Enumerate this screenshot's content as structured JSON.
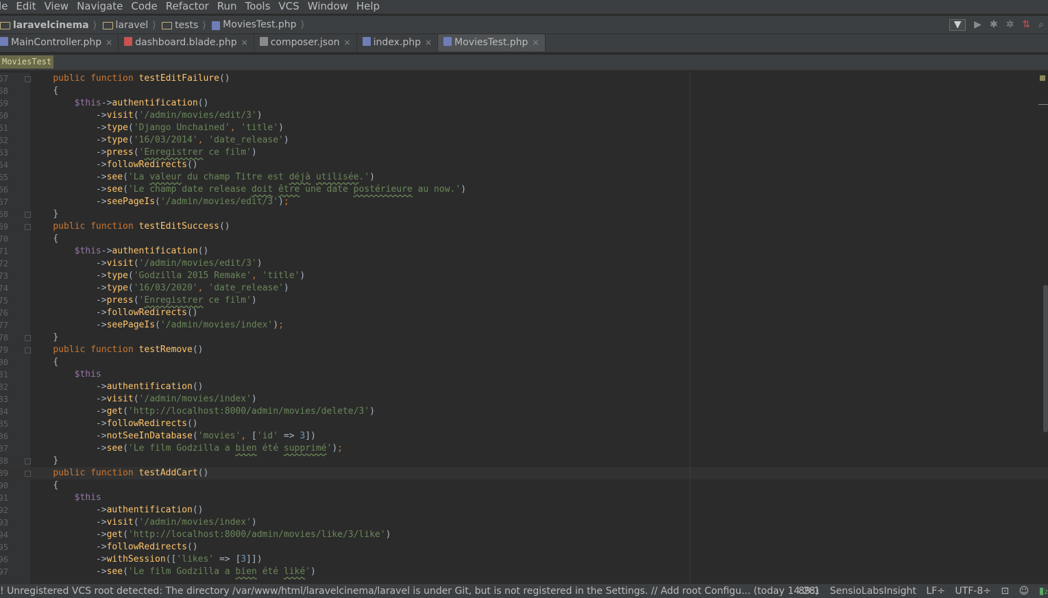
{
  "menu": [
    "le",
    "Edit",
    "View",
    "Navigate",
    "Code",
    "Refactor",
    "Run",
    "Tools",
    "VCS",
    "Window",
    "Help"
  ],
  "breadcrumb": [
    "laravelcinema",
    "laravel",
    "tests",
    "MoviesTest.php"
  ],
  "tabs": [
    {
      "label": "MainController.php",
      "icon": "php-file-icon",
      "active": false
    },
    {
      "label": "dashboard.blade.php",
      "icon": "blade-file-icon",
      "active": false
    },
    {
      "label": "composer.json",
      "icon": "json-file-icon",
      "active": false
    },
    {
      "label": "index.php",
      "icon": "php-file-icon",
      "active": false
    },
    {
      "label": "MoviesTest.php",
      "icon": "php-file-icon",
      "active": true
    }
  ],
  "class_crumb": "MoviesTest",
  "code_lines": [
    {
      "n": "57",
      "fold": true,
      "src": "    <span class=\"kw\">public function</span> <span class=\"fn\">testEditFailure</span><span class=\"pl\">()</span>"
    },
    {
      "n": "58",
      "src": "    <span class=\"pl\">{</span>"
    },
    {
      "n": "59",
      "src": "        <span class=\"var\">$this</span><span class=\"pl\">-></span><span class=\"fn\">authentification</span><span class=\"pl\">()</span>"
    },
    {
      "n": "60",
      "src": "            <span class=\"pl\">-></span><span class=\"fn\">visit</span><span class=\"pl\">(</span><span class=\"str\">'/admin/movies/edit/3'</span><span class=\"pl\">)</span>"
    },
    {
      "n": "61",
      "src": "            <span class=\"pl\">-></span><span class=\"fn\">type</span><span class=\"pl\">(</span><span class=\"str\">'Django Unchained'</span><span class=\"kw\">,</span> <span class=\"str\">'title'</span><span class=\"pl\">)</span>"
    },
    {
      "n": "62",
      "src": "            <span class=\"pl\">-></span><span class=\"fn\">type</span><span class=\"pl\">(</span><span class=\"str\">'16/03/2014'</span><span class=\"kw\">,</span> <span class=\"str\">'date_release'</span><span class=\"pl\">)</span>"
    },
    {
      "n": "63",
      "src": "            <span class=\"pl\">-></span><span class=\"fn\">press</span><span class=\"pl\">(</span><span class=\"str\">'<span class=\"typo\">Enregistrer</span> ce film'</span><span class=\"pl\">)</span>"
    },
    {
      "n": "64",
      "src": "            <span class=\"pl\">-></span><span class=\"fn\">followRedirects</span><span class=\"pl\">()</span>"
    },
    {
      "n": "65",
      "src": "            <span class=\"pl\">-></span><span class=\"fn\">see</span><span class=\"pl\">(</span><span class=\"str\">'La <span class=\"typo\">valeur</span> du champ Titre est <span class=\"typo\">déjà</span> <span class=\"typo\">utilisée</span>.'</span><span class=\"pl\">)</span>"
    },
    {
      "n": "66",
      "src": "            <span class=\"pl\">-></span><span class=\"fn\">see</span><span class=\"pl\">(</span><span class=\"str\">'Le champ date release <span class=\"typo\">doit</span> <span class=\"typo\">être</span> une date <span class=\"typo\">postérieure</span> au now.'</span><span class=\"pl\">)</span>"
    },
    {
      "n": "67",
      "src": "            <span class=\"pl\">-></span><span class=\"fn\">seePageIs</span><span class=\"pl\">(</span><span class=\"str\">'/admin/movies/edit/3'</span><span class=\"pl\">)</span><span class=\"kw\">;</span>"
    },
    {
      "n": "68",
      "fold": true,
      "src": "    <span class=\"pl\">}</span>"
    },
    {
      "n": "69",
      "fold": true,
      "src": "    <span class=\"kw\">public function</span> <span class=\"fn\">testEditSuccess</span><span class=\"pl\">()</span>"
    },
    {
      "n": "70",
      "src": "    <span class=\"pl\">{</span>"
    },
    {
      "n": "71",
      "src": "        <span class=\"var\">$this</span><span class=\"pl\">-></span><span class=\"fn\">authentification</span><span class=\"pl\">()</span>"
    },
    {
      "n": "72",
      "src": "            <span class=\"pl\">-></span><span class=\"fn\">visit</span><span class=\"pl\">(</span><span class=\"str\">'/admin/movies/edit/3'</span><span class=\"pl\">)</span>"
    },
    {
      "n": "73",
      "src": "            <span class=\"pl\">-></span><span class=\"fn\">type</span><span class=\"pl\">(</span><span class=\"str\">'Godzilla 2015 Remake'</span><span class=\"kw\">,</span> <span class=\"str\">'title'</span><span class=\"pl\">)</span>"
    },
    {
      "n": "74",
      "src": "            <span class=\"pl\">-></span><span class=\"fn\">type</span><span class=\"pl\">(</span><span class=\"str\">'16/03/2020'</span><span class=\"kw\">,</span> <span class=\"str\">'date_release'</span><span class=\"pl\">)</span>"
    },
    {
      "n": "75",
      "src": "            <span class=\"pl\">-></span><span class=\"fn\">press</span><span class=\"pl\">(</span><span class=\"str\">'<span class=\"typo\">Enregistrer</span> ce film'</span><span class=\"pl\">)</span>"
    },
    {
      "n": "76",
      "src": "            <span class=\"pl\">-></span><span class=\"fn\">followRedirects</span><span class=\"pl\">()</span>"
    },
    {
      "n": "77",
      "src": "            <span class=\"pl\">-></span><span class=\"fn\">seePageIs</span><span class=\"pl\">(</span><span class=\"str\">'/admin/movies/index'</span><span class=\"pl\">)</span><span class=\"kw\">;</span>"
    },
    {
      "n": "78",
      "fold": true,
      "src": "    <span class=\"pl\">}</span>"
    },
    {
      "n": "79",
      "fold": true,
      "src": "    <span class=\"kw\">public function</span> <span class=\"fn\">testRemove</span><span class=\"pl\">()</span>"
    },
    {
      "n": "80",
      "src": "    <span class=\"pl\">{</span>"
    },
    {
      "n": "81",
      "src": "        <span class=\"var\">$this</span>"
    },
    {
      "n": "82",
      "src": "            <span class=\"pl\">-></span><span class=\"fn\">authentification</span><span class=\"pl\">()</span>"
    },
    {
      "n": "83",
      "src": "            <span class=\"pl\">-></span><span class=\"fn\">visit</span><span class=\"pl\">(</span><span class=\"str\">'/admin/movies/index'</span><span class=\"pl\">)</span>"
    },
    {
      "n": "84",
      "src": "            <span class=\"pl\">-></span><span class=\"fn\">get</span><span class=\"pl\">(</span><span class=\"str\">'http://localhost:8000/admin/movies/delete/3'</span><span class=\"pl\">)</span>"
    },
    {
      "n": "85",
      "src": "            <span class=\"pl\">-></span><span class=\"fn\">followRedirects</span><span class=\"pl\">()</span>"
    },
    {
      "n": "86",
      "src": "            <span class=\"pl\">-></span><span class=\"fn\">notSeeInDatabase</span><span class=\"pl\">(</span><span class=\"str\">'movies'</span><span class=\"kw\">,</span> <span class=\"pl\">[</span><span class=\"str\">'id'</span> <span class=\"pl\">=></span> <span class=\"num\">3</span><span class=\"pl\">])</span>"
    },
    {
      "n": "87",
      "src": "            <span class=\"pl\">-></span><span class=\"fn\">see</span><span class=\"pl\">(</span><span class=\"str\">'Le film Godzilla a <span class=\"typo\">bien</span> été <span class=\"typo\">supprimé</span>'</span><span class=\"pl\">)</span><span class=\"kw\">;</span>"
    },
    {
      "n": "88",
      "fold": true,
      "src": "    <span class=\"pl\">}</span>"
    },
    {
      "n": "89",
      "fold": true,
      "current": true,
      "src": "    <span class=\"kw\">public function</span> <span class=\"fn\">testAddCart</span><span class=\"pl\">()</span>"
    },
    {
      "n": "90",
      "src": "    <span class=\"pl\">{</span>"
    },
    {
      "n": "91",
      "src": "        <span class=\"var\">$this</span>"
    },
    {
      "n": "92",
      "src": "            <span class=\"pl\">-></span><span class=\"fn\">authentification</span><span class=\"pl\">()</span>"
    },
    {
      "n": "93",
      "src": "            <span class=\"pl\">-></span><span class=\"fn\">visit</span><span class=\"pl\">(</span><span class=\"str\">'/admin/movies/index'</span><span class=\"pl\">)</span>"
    },
    {
      "n": "94",
      "src": "            <span class=\"pl\">-></span><span class=\"fn\">get</span><span class=\"pl\">(</span><span class=\"str\">'http://localhost:8000/admin/movies/like/3/like'</span><span class=\"pl\">)</span>"
    },
    {
      "n": "95",
      "src": "            <span class=\"pl\">-></span><span class=\"fn\">followRedirects</span><span class=\"pl\">()</span>"
    },
    {
      "n": "96",
      "src": "            <span class=\"pl\">-></span><span class=\"fn\">withSession</span><span class=\"pl\">([</span><span class=\"str\">'likes'</span> <span class=\"pl\">=></span> <span class=\"pl\">[</span><span class=\"num\">3</span><span class=\"pl\">]])</span>"
    },
    {
      "n": "97",
      "src": "            <span class=\"pl\">-></span><span class=\"fn\">see</span><span class=\"pl\">(</span><span class=\"str\">'Le film Godzilla a <span class=\"typo\">bien</span> été <span class=\"typo\">liké</span>'</span><span class=\"pl\">)</span>"
    }
  ],
  "status": {
    "message": "Unregistered VCS root detected: The directory /var/www/html/laravelcinema/laravel is under Git, but is not registered in the Settings. // Add root  Configu... (today 14:28)",
    "position": "89:1",
    "plugin": "SensioLabsInsight",
    "line_sep": "LF÷",
    "encoding": "UTF-8÷"
  }
}
